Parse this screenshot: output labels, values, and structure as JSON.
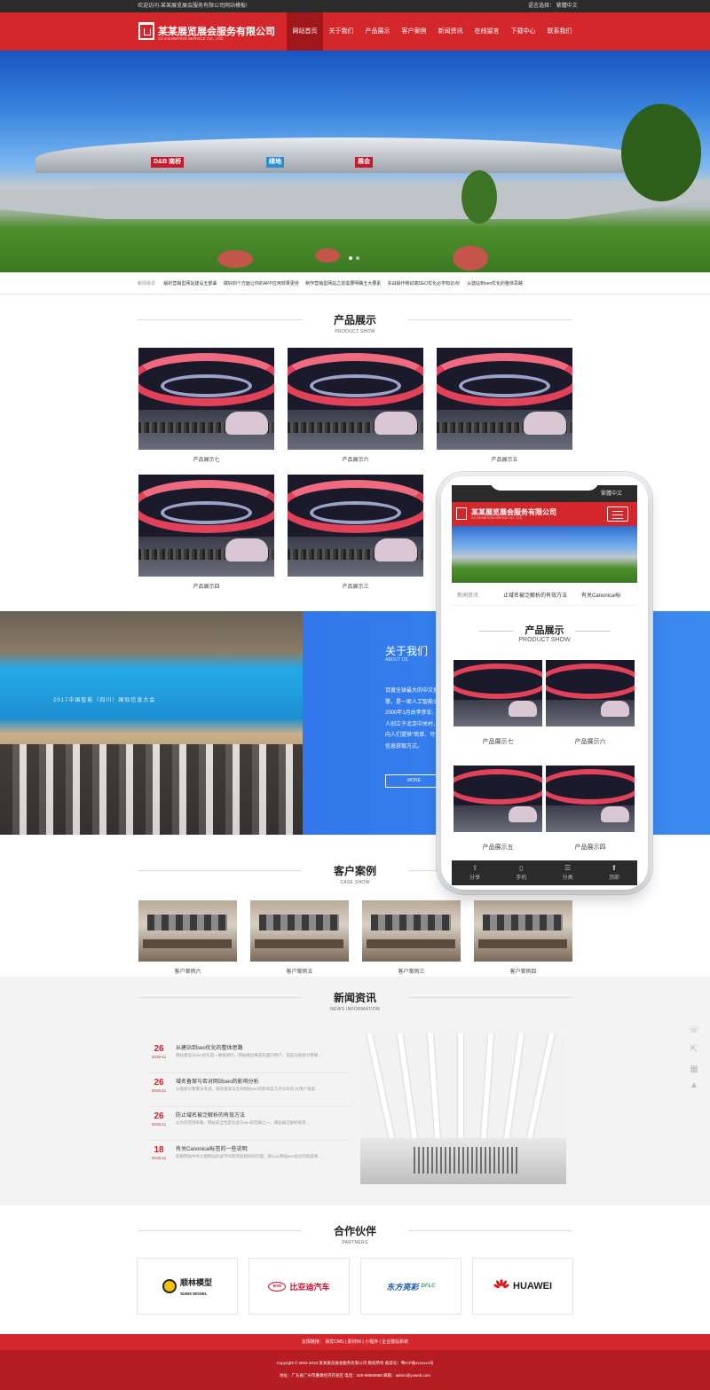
{
  "topbar": {
    "welcome": "欢迎访问-某某展览展会服务有限公司网站模板!",
    "lang_label": "语言选择：",
    "lang_value": "繁體中文"
  },
  "header": {
    "logo_cn": "某某展览展会服务有限公司",
    "logo_en": "XX EXHIBITION SERVICE CO., LTD",
    "nav": [
      "网站首页",
      "关于我们",
      "产品展示",
      "客户案例",
      "新闻资讯",
      "在线留言",
      "下载中心",
      "联系我们"
    ],
    "active_nav": 0
  },
  "banner": {
    "signs": [
      "D&B 南桥",
      "绿地",
      "展会"
    ]
  },
  "ticker": {
    "label": "新闻资讯",
    "items": [
      "解析营销型网站建设五部曲",
      "做好四个方面让你的APP应用效果更佳",
      "制作营销型网站之前需要明确五大要素",
      "实战操作移动端SEO优化必学知识点!",
      "从建站到seo优化的整体思路"
    ]
  },
  "products": {
    "title": "产品展示",
    "subtitle": "PRODUCT SHOW",
    "items": [
      "产品展示七",
      "产品展示六",
      "产品展示五",
      "产品展示四",
      "产品展示三"
    ]
  },
  "about": {
    "title": "关于我们",
    "subtitle": "ABOUT US",
    "text": "百度全球最大的中文搜索引擎，是一家人工智能公司。2000年1月由李彦宏、徐勇两人创立于北京中关村，致力于向人们提供\"简单、可依赖\"的信息获取方式。",
    "more": "MORE",
    "screen_text": "2017中国智能（四川）国际信息大会"
  },
  "cases": {
    "title": "客户案例",
    "subtitle": "CASE SHOW",
    "items": [
      "客户案例六",
      "客户案例五",
      "客户案例三",
      "客户案例四"
    ]
  },
  "news": {
    "title": "新闻资讯",
    "subtitle": "NEWS INFORMATION",
    "items": [
      {
        "day": "26",
        "ym": "2019-11",
        "title": "从建站到seo优化的整体思路",
        "summary": "网站建设与seo优化是一脉相承的，网站做出来首先面向用户，但是与搜索引擎联..."
      },
      {
        "day": "26",
        "ym": "2019-11",
        "title": "域名备案与否对网站seo的影响分析",
        "summary": "从搜索引擎算法考虑，域名备案与否对网站seo的影响是几乎没有的,从用户角度..."
      },
      {
        "day": "26",
        "ym": "2019-11",
        "title": "防止域名被泛解析的有效方法",
        "summary": "从大的范围来看，网站安全性是包含于seo的范畴之一。域名被泛解析被黑..."
      },
      {
        "day": "18",
        "ym": "2019-11",
        "title": "有关Canonical标签的一些说明",
        "summary": "如果网站中有大量网址形式不同而内容相同的页面，那么从网站seo优化的角度来..."
      }
    ]
  },
  "partners": {
    "title": "合作伙伴",
    "subtitle": "PARTNERS",
    "items": [
      {
        "name": "顺林模型",
        "sub": "SUMS MODEL",
        "color": "#222222"
      },
      {
        "name": "比亚迪汽车",
        "sub": "BYD",
        "color": "#c8102e"
      },
      {
        "name": "东方亮彩",
        "sub": "DFLC",
        "color": "#1a56a6"
      },
      {
        "name": "HUAWEI",
        "sub": "",
        "color": "#222222"
      }
    ]
  },
  "footer": {
    "links_label": "友情链接：",
    "links": [
      "易优CMS",
      "素材56",
      "小程序",
      "企业建站系统"
    ],
    "copyright": "Copyright © 2002-2019 某某展览展会服务有限公司 版权所有  备案号：粤ICP备xxxxxxx号",
    "address": "地址：广东省广州市番禺经济开发区  电话：020-88888888  邮箱：admin@yoweb.com"
  },
  "phone": {
    "lang": "繁體中文",
    "logo_cn": "某某展览展会服务有限公司",
    "logo_en": "XX EXHIBITION SERVICE CO., LTD",
    "ticker_label": "新闻资讯",
    "ticker_items": [
      "止域名被泛解析的有效方法",
      "有关Canonical标"
    ],
    "prod_title": "产品展示",
    "prod_sub": "PRODUCT SHOW",
    "products": [
      "产品展示七",
      "产品展示六",
      "产品展示五",
      "产品展示四"
    ],
    "tabs": [
      {
        "icon": "share-icon",
        "label": "分享"
      },
      {
        "icon": "phone-icon",
        "label": "手机"
      },
      {
        "icon": "category-icon",
        "label": "分类"
      },
      {
        "icon": "top-icon",
        "label": "顶部"
      }
    ]
  },
  "colors": {
    "brand_red": "#d3272b",
    "dark_red": "#a0171b",
    "about_blue": "#2b6ae8"
  }
}
